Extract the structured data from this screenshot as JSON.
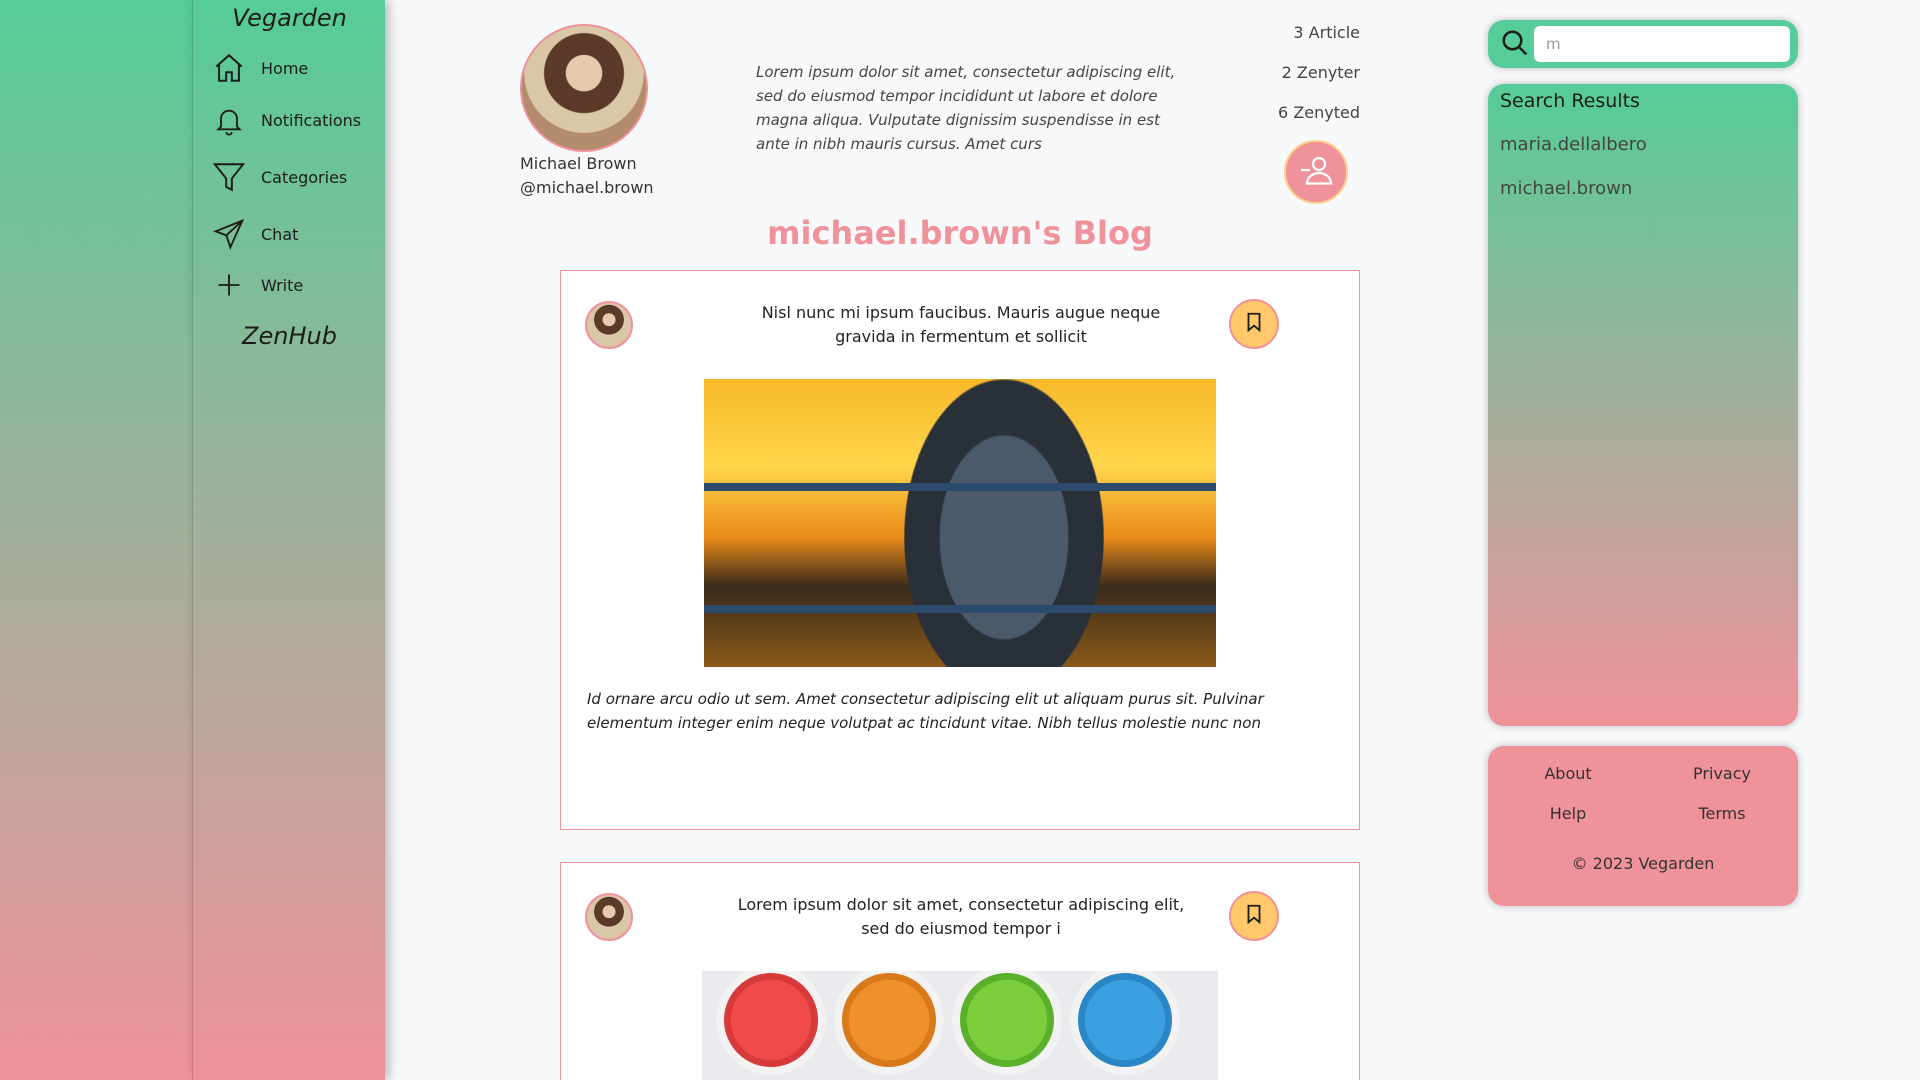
{
  "sidebar": {
    "brand": "Vegarden",
    "items": [
      {
        "label": "Home",
        "icon": "home-icon"
      },
      {
        "label": "Notifications",
        "icon": "bell-icon"
      },
      {
        "label": "Categories",
        "icon": "filter-icon"
      },
      {
        "label": "Chat",
        "icon": "send-icon"
      },
      {
        "label": "Write",
        "icon": "plus-icon"
      }
    ],
    "footer_brand": "ZenHub"
  },
  "profile": {
    "name": "Michael Brown",
    "handle": "@michael.brown",
    "bio": "Lorem ipsum dolor sit amet, consectetur adipiscing elit, sed do eiusmod tempor incididunt ut labore et dolore magna aliqua. Vulputate dignissim suspendisse in est ante in nibh mauris cursus. Amet curs",
    "stats": {
      "articles": "3 Article",
      "zenyter": "2 Zenyter",
      "zenyted": "6 Zenyted"
    }
  },
  "blog": {
    "title": "michael.brown's Blog",
    "posts": [
      {
        "title": "Nisl nunc mi ipsum faucibus. Mauris augue neque gravida in fermentum et sollicit",
        "excerpt": "Id ornare arcu odio ut sem. Amet consectetur adipiscing elit ut aliquam purus sit. Pulvinar elementum integer enim neque volutpat ac tincidunt vitae. Nibh tellus molestie nunc non"
      },
      {
        "title": "Lorem ipsum dolor sit amet, consectetur adipiscing elit, sed do eiusmod tempor i"
      }
    ]
  },
  "search": {
    "value": "m",
    "results_title": "Search Results",
    "results": [
      "maria.dellalbero",
      "michael.brown"
    ]
  },
  "footer": {
    "about": "About",
    "privacy": "Privacy",
    "help": "Help",
    "terms": "Terms",
    "copyright": "© 2023 Vegarden"
  },
  "colors": {
    "accent_green": "#55cc99",
    "accent_pink": "#f0929a",
    "accent_yellow": "#ffc86a"
  }
}
